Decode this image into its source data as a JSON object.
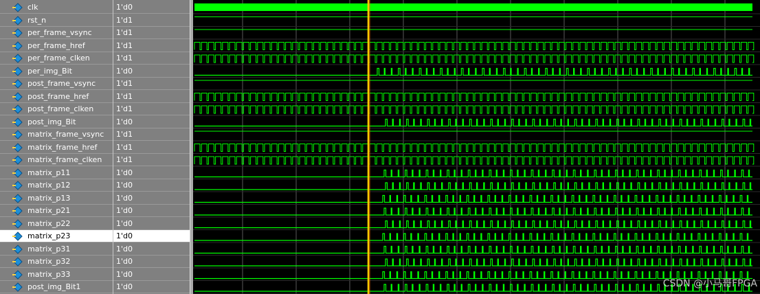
{
  "signals": [
    {
      "name": "clk",
      "value": "1'd0"
    },
    {
      "name": "rst_n",
      "value": "1'd1"
    },
    {
      "name": "per_frame_vsync",
      "value": "1'd1"
    },
    {
      "name": "per_frame_href",
      "value": "1'd1"
    },
    {
      "name": "per_frame_clken",
      "value": "1'd1"
    },
    {
      "name": "per_img_Bit",
      "value": "1'd0"
    },
    {
      "name": "post_frame_vsync",
      "value": "1'd1"
    },
    {
      "name": "post_frame_href",
      "value": "1'd1"
    },
    {
      "name": "post_frame_clken",
      "value": "1'd1"
    },
    {
      "name": "post_img_Bit",
      "value": "1'd0"
    },
    {
      "name": "matrix_frame_vsync",
      "value": "1'd1"
    },
    {
      "name": "matrix_frame_href",
      "value": "1'd1"
    },
    {
      "name": "matrix_frame_clken",
      "value": "1'd1"
    },
    {
      "name": "matrix_p11",
      "value": "1'd0"
    },
    {
      "name": "matrix_p12",
      "value": "1'd0"
    },
    {
      "name": "matrix_p13",
      "value": "1'd0"
    },
    {
      "name": "matrix_p21",
      "value": "1'd0"
    },
    {
      "name": "matrix_p22",
      "value": "1'd0"
    },
    {
      "name": "matrix_p23",
      "value": "1'd0",
      "selected": true
    },
    {
      "name": "matrix_p31",
      "value": "1'd0"
    },
    {
      "name": "matrix_p32",
      "value": "1'd0"
    },
    {
      "name": "matrix_p33",
      "value": "1'd0"
    },
    {
      "name": "post_img_Bit1",
      "value": "1'd0"
    }
  ],
  "colors": {
    "wave": "#00ff00",
    "cursor": "#ffcc00",
    "grid": "#5a5a5a",
    "background": "#000000",
    "pane": "#808080",
    "icon": "#1e8fd8"
  },
  "watermark": "CSDN @小马哥FPGA"
}
